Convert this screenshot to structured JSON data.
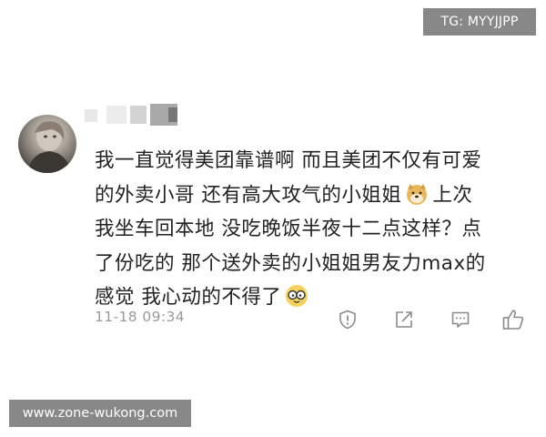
{
  "badge": {
    "text": "TG: MYYJJPP"
  },
  "comment": {
    "avatar_icon": "profile-avatar",
    "lines": [
      {
        "text": "我一直觉得美团靠谱啊 而且美团不仅有可爱"
      },
      {
        "text": "的外卖小哥 还有高大攻气的小姐姐",
        "emoji": "doge-emoji",
        "after": "上次"
      },
      {
        "text": "我坐车回本地 没吃晚饭半夜十二点这样？点"
      },
      {
        "text": "了份吃的  那个送外卖的小姐姐男友力max的"
      },
      {
        "text": "感觉 我心动的不得了",
        "emoji": "nerd-glasses-emoji"
      }
    ],
    "timestamp": "11-18 09:34",
    "actions": [
      {
        "icon": "report-icon"
      },
      {
        "icon": "share-icon"
      },
      {
        "icon": "comment-icon"
      },
      {
        "icon": "thumbs-up-icon"
      }
    ]
  },
  "watermark": {
    "text": "www.zone-wukong.com"
  },
  "colors": {
    "text": "#222222",
    "meta": "#9a9a9a",
    "icon": "#8a8a8a",
    "overlay": "#6e6e6e"
  }
}
